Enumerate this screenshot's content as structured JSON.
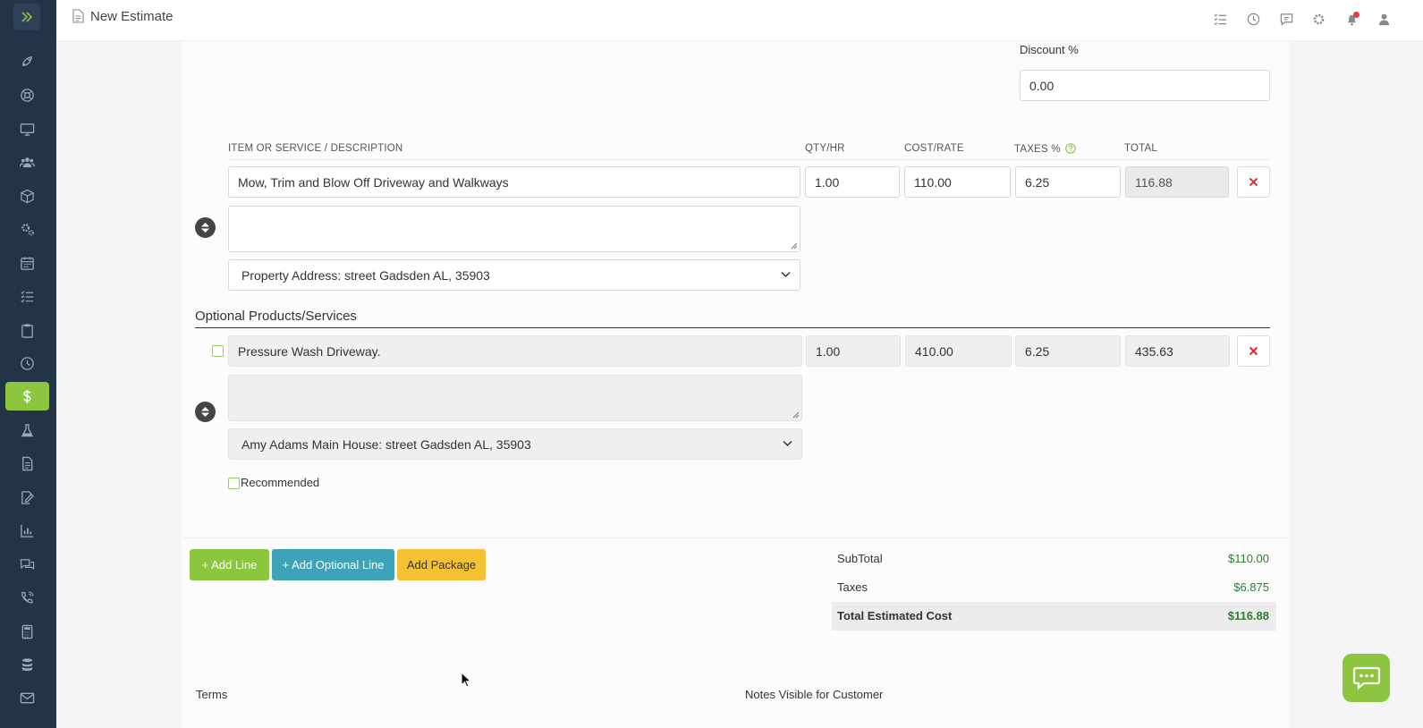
{
  "header": {
    "title": "New Estimate"
  },
  "discount": {
    "label": "Discount %",
    "value": "0.00"
  },
  "columns": {
    "item": "ITEM OR SERVICE / DESCRIPTION",
    "qty": "QTY/HR",
    "cost": "COST/RATE",
    "taxes": "TAXES %",
    "total": "TOTAL"
  },
  "line_item": {
    "name": "Mow, Trim and Blow Off Driveway and Walkways",
    "qty": "1.00",
    "cost": "110.00",
    "taxes": "6.25",
    "total": "116.88",
    "address": "Property Address: street Gadsden AL, 35903"
  },
  "optional": {
    "section_title": "Optional Products/Services",
    "name": "Pressure Wash Driveway.",
    "qty": "1.00",
    "cost": "410.00",
    "taxes": "6.25",
    "total": "435.63",
    "address": "Amy Adams Main House: street Gadsden AL, 35903",
    "recommended_label": "Recommended"
  },
  "buttons": {
    "add_line": "+ Add Line",
    "add_optional": "+ Add Optional Line",
    "add_package": "Add Package"
  },
  "summary": {
    "subtotal_label": "SubTotal",
    "subtotal": "$110.00",
    "taxes_label": "Taxes",
    "taxes": "$6.875",
    "total_label": "Total Estimated Cost",
    "total": "$116.88"
  },
  "footer": {
    "terms": "Terms",
    "notes": "Notes Visible for Customer"
  },
  "colors": {
    "sidebar": "#233348",
    "accent_green": "#8cc63f",
    "teal": "#3ea3b7",
    "yellow": "#f6c234",
    "delete_red": "#d32f2f",
    "money_green": "#2e7d32"
  },
  "sidebar_icons": [
    "rocket-icon",
    "support-icon",
    "monitor-icon",
    "users-icon",
    "box-icon",
    "gears-icon",
    "calendar-icon",
    "checklist-icon",
    "clipboard-icon",
    "clock-icon",
    "dollar-icon",
    "flask-icon",
    "document-icon",
    "signature-icon",
    "chart-icon",
    "chat-icon",
    "phone-icon",
    "calculator-icon",
    "database-icon",
    "mail-icon"
  ],
  "top_icons": [
    "tasks-icon",
    "clock-icon",
    "message-icon",
    "settings-icon",
    "bell-icon",
    "user-icon"
  ]
}
